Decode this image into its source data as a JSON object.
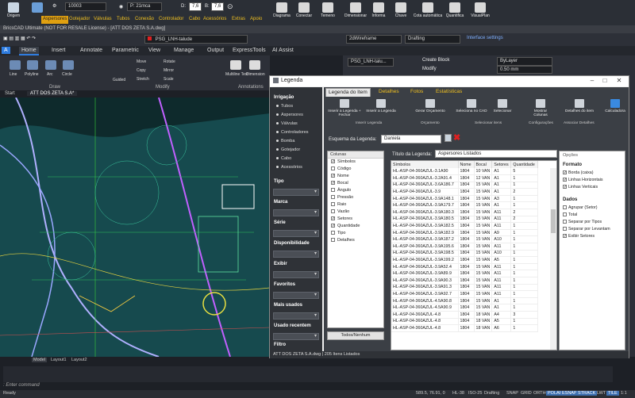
{
  "plugin_toolbar": {
    "left_buttons": [
      {
        "label": "Origem",
        "icon": "faucet-icon"
      },
      {
        "label": "Pipes",
        "icon": "pipes-icon"
      }
    ],
    "main_buttons": [
      {
        "label": "Diagrama",
        "icon": "diagram-icon"
      },
      {
        "label": "Conectar",
        "icon": "connect-icon"
      },
      {
        "label": "Temeno",
        "icon": "terrain-icon"
      },
      {
        "label": "Dimensionar",
        "icon": "dimension-icon"
      },
      {
        "label": "Informa",
        "icon": "info-icon"
      },
      {
        "label": "Chave",
        "icon": "key-icon"
      },
      {
        "label": "Cota automática",
        "icon": "auto-dimension-icon"
      },
      {
        "label": "Quantifica",
        "icon": "quantify-icon"
      },
      {
        "label": "VisualPlan",
        "icon": "visualplan-icon"
      }
    ],
    "combo_a": "10003",
    "combo_b": "P: 21mca",
    "d_value": "7,6",
    "b_value": "7,6",
    "tabs": [
      "Aspersores",
      "Gotejador",
      "Válvulas",
      "Tubos",
      "Conexão",
      "Controlador",
      "Cabo",
      "Acessórios",
      "Extras",
      "Apoio"
    ],
    "active_tab": "Aspersores"
  },
  "window_title": "BricsCAD Ultimate (NOT FOR RESALE License) - [ATT DOS ZETA S.A.dwg]",
  "quick_access": {
    "layer": "PSG_LNH-talude",
    "visual_style": "2dWireframe",
    "workspace": "Drafting",
    "interface_settings": "Interface settings"
  },
  "ribbon_tabs": [
    "Home",
    "Insert",
    "Annotate",
    "Parametric",
    "View",
    "Manage",
    "Output",
    "ExpressTools",
    "AI Assist"
  ],
  "ribbon": {
    "draw_tools": [
      "Line",
      "Polyline",
      "Arc",
      "Circle"
    ],
    "modify_tools": [
      "Move",
      "Rotate",
      "Copy",
      "Mirror",
      "Stretch",
      "Scale"
    ],
    "other_tools": [
      "Guided",
      "Multiline Text",
      "Dimension"
    ],
    "groups": [
      "Draw",
      "Modify",
      "Annotations"
    ],
    "right_tools": [
      "Create Block",
      "Modify"
    ],
    "layer_combo": "PSG_LNH-talu...",
    "bylayer": "ByLayer",
    "lineweight": "0.50 mm"
  },
  "doc_tabs": [
    "Start",
    "ATT DOS ZETA S.A*"
  ],
  "active_doc": "ATT DOS ZETA S.A*",
  "dialog": {
    "title": "Legenda",
    "left_panel": {
      "irrigacao_title": "Irrigação",
      "irrigacao_items": [
        "Tubos",
        "Aspersores",
        "Válvulas",
        "Controladores",
        "Bomba",
        "Gotejador",
        "Cabo",
        "Acessórios"
      ],
      "sections": [
        "Tipo",
        "Marca",
        "Série",
        "Disponibilidade",
        "Exibir",
        "Favoritos",
        "Mais usados",
        "Usado recentem",
        "Filtro"
      ]
    },
    "tabs": [
      "Legenda do Item",
      "Detalhes",
      "Fotos",
      "Estatísticas"
    ],
    "active_tab": "Legenda do Item",
    "toolbar_buttons": [
      "Inserir a Legenda + Fechar",
      "Inserir a Legenda",
      "Gerar Orçamento",
      "Seleciona no CAD",
      "Selecionar",
      "Mostrar Colunas",
      "Detalhes do item",
      "Calculadora"
    ],
    "toolbar_groups": [
      "Inserir Legenda",
      "Orçamento",
      "Selecionar itens",
      "Configurações",
      "Associar Detalhes"
    ],
    "esquema_label": "Esquema da Legenda:",
    "esquema_value": "Daniela",
    "colunas_title": "Colunas",
    "colunas": [
      {
        "label": "Símbolos",
        "checked": true
      },
      {
        "label": "Código",
        "checked": false
      },
      {
        "label": "Nome",
        "checked": true
      },
      {
        "label": "Bocal",
        "checked": true
      },
      {
        "label": "Ângulo",
        "checked": false
      },
      {
        "label": "Pressão",
        "checked": false
      },
      {
        "label": "Raio",
        "checked": false
      },
      {
        "label": "Vazão",
        "checked": false
      },
      {
        "label": "Setores",
        "checked": true
      },
      {
        "label": "Quantidade",
        "checked": true
      },
      {
        "label": "Tipo",
        "checked": false
      },
      {
        "label": "Detalhes",
        "checked": false
      }
    ],
    "todos_button": "Todos/Nenhum",
    "titulo_label": "Título da Legenda:",
    "titulo_value": "Aspersores Listados",
    "table_headers": [
      "Símbolos",
      "Nome",
      "Bocal",
      "Setores",
      "Quantidade"
    ],
    "table_rows": [
      [
        "HL-ASP-04-360AZUL-3.1A90",
        "1804",
        "10 VAN",
        "A1",
        "5"
      ],
      [
        "HL-ASP-04-360AZUL-3.2A91.4",
        "1804",
        "12 VAN",
        "A1",
        "1"
      ],
      [
        "HL-ASP-04-360AZUL-3.6A186.7",
        "1804",
        "15 VAN",
        "A1",
        "1"
      ],
      [
        "HL-ASP-04-360AZUL-3.9",
        "1804",
        "15 VAN",
        "A1",
        "2"
      ],
      [
        "HL-ASP-04-360AZUL-3.9A148.1",
        "1804",
        "15 VAN",
        "A3",
        "1"
      ],
      [
        "HL-ASP-04-360AZUL-3.9A179.7",
        "1804",
        "15 VAN",
        "A1",
        "1"
      ],
      [
        "HL-ASP-04-360AZUL-3.9A180.3",
        "1804",
        "15 VAN",
        "A11",
        "2"
      ],
      [
        "HL-ASP-04-360AZUL-3.9A180.5",
        "1804",
        "15 VAN",
        "A11",
        "2"
      ],
      [
        "HL-ASP-04-360AZUL-3.9A182.5",
        "1804",
        "15 VAN",
        "A11",
        "1"
      ],
      [
        "HL-ASP-04-360AZUL-3.9A182.9",
        "1804",
        "15 VAN",
        "A9",
        "1"
      ],
      [
        "HL-ASP-04-360AZUL-3.9A187.2",
        "1804",
        "15 VAN",
        "A10",
        "1"
      ],
      [
        "HL-ASP-04-360AZUL-3.9A195.6",
        "1804",
        "15 VAN",
        "A11",
        "1"
      ],
      [
        "HL-ASP-04-360AZUL-3.9A198.5",
        "1804",
        "15 VAN",
        "A10",
        "1"
      ],
      [
        "HL-ASP-04-360AZUL-3.9A199.2",
        "1804",
        "15 VAN",
        "A5",
        "1"
      ],
      [
        "HL-ASP-04-360AZUL-3.9A52.4",
        "1804",
        "15 VAN",
        "A11",
        "1"
      ],
      [
        "HL-ASP-04-360AZUL-3.9A89.9",
        "1804",
        "15 VAN",
        "A11",
        "1"
      ],
      [
        "HL-ASP-04-360AZUL-3.9A90.3",
        "1804",
        "15 VAN",
        "A11",
        "1"
      ],
      [
        "HL-ASP-04-360AZUL-3.9A91.3",
        "1804",
        "15 VAN",
        "A11",
        "1"
      ],
      [
        "HL-ASP-04-360AZUL-3.9A92.7",
        "1804",
        "15 VAN",
        "A11",
        "1"
      ],
      [
        "HL-ASP-04-360AZUL-4.5A90.8",
        "1804",
        "15 VAN",
        "A1",
        "1"
      ],
      [
        "HL-ASP-04-360AZUL-4.5A90.9",
        "1804",
        "15 VAN",
        "A1",
        "1"
      ],
      [
        "HL-ASP-04-360AZUL-4.8",
        "1804",
        "18 VAN",
        "A4",
        "3"
      ],
      [
        "HL-ASP-04-360AZUL-4.8",
        "1804",
        "18 VAN",
        "A5",
        "1"
      ],
      [
        "HL-ASP-04-360AZUL-4.8",
        "1804",
        "18 VAN",
        "A6",
        "1"
      ]
    ],
    "options_title": "Opções",
    "formato_title": "Formato",
    "formato_items": [
      {
        "label": "Borda (caixa)",
        "checked": true
      },
      {
        "label": "Linhas Horizontais",
        "checked": true
      },
      {
        "label": "Linhas Verticais",
        "checked": true
      }
    ],
    "dados_title": "Dados",
    "dados_items": [
      {
        "label": "Agrupar (Setor)",
        "checked": false
      },
      {
        "label": "Total",
        "checked": false
      },
      {
        "label": "Separar por Tipos",
        "checked": false
      },
      {
        "label": "Separar por Levantam",
        "checked": false
      },
      {
        "label": "Exibir Setores",
        "checked": true
      }
    ],
    "status": "ATT DOS ZETA S.A.dwg | 205 Itens Listados"
  },
  "model_tabs": [
    "Model",
    "Layout1",
    "Layout2"
  ],
  "command_prompt": ": Enter command",
  "status_bar": {
    "ready": "Ready",
    "coords": "589.5, 76.91, 0",
    "units": "HL-38",
    "iso": "ISO-25",
    "workspace": "Drafting",
    "toggles": [
      "SNAP",
      "GRID",
      "ORTHO",
      "POLAR",
      "ESNAP",
      "STRACK",
      "LWT",
      "TILE",
      "1:1"
    ],
    "active_toggles": [
      "POLAR",
      "ESNAP",
      "STRACK",
      "TILE"
    ]
  }
}
